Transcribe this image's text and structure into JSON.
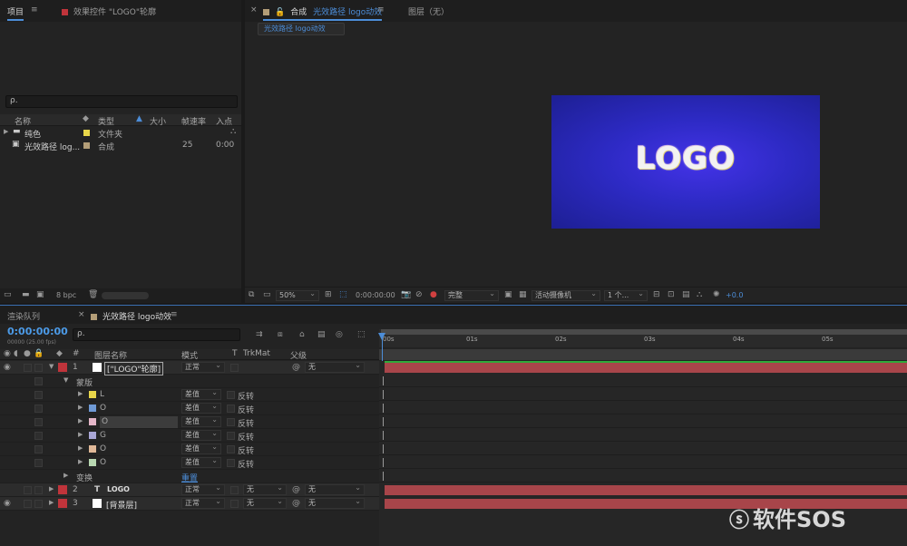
{
  "project_panel": {
    "tab_label": "项目",
    "effects_tab_label": "效果控件 \"LOGO\"轮廓",
    "search_placeholder": "ρ.",
    "columns": [
      "名称",
      "类型",
      "大小",
      "帧速率",
      "入点"
    ],
    "items": [
      {
        "name": "纯色",
        "type": "文件夹",
        "fps": "",
        "inpoint": "",
        "swatch": "#e8d64a"
      },
      {
        "name": "光效路径 log...",
        "type": "合成",
        "fps": "25",
        "inpoint": "0:00",
        "swatch": "#b49e78"
      }
    ],
    "bpc_label": "8 bpc"
  },
  "composition_panel": {
    "tab_label": "合成",
    "comp_name": "光效路径 logo动效",
    "layer_tab_label": "图层（无）",
    "subtab_label": "光效路径 logo动效",
    "logo_text": "LOGO",
    "zoom": "50%",
    "timecode": "0:00:00:00",
    "quality": "完整",
    "camera": "活动摄像机",
    "views": "1 个...",
    "exposure": "+0.0"
  },
  "timeline_panel": {
    "render_queue_label": "渲染队列",
    "comp_tab_label": "光效路径 logo动效",
    "timecode": "0:00:00:00",
    "frame_info": "00000 (25.00 fps)",
    "search_placeholder": "ρ.",
    "header": {
      "num": "#",
      "layer_name": "图层名称",
      "mode": "模式",
      "t": "T",
      "trkmat": "TrkMat",
      "parent": "父级"
    },
    "ruler_ticks": [
      "00s",
      "01s",
      "02s",
      "03s",
      "04s",
      "05s"
    ],
    "layers": [
      {
        "num": "1",
        "name": "[\"LOGO\"轮廓]",
        "mode": "正常",
        "trkmat": "",
        "parent": "无",
        "color": "#c0343b",
        "expanded": true,
        "kind": "solid-white"
      },
      {
        "num": "2",
        "name": "LOGO",
        "mode": "正常",
        "trkmat": "无",
        "parent": "无",
        "color": "#c0343b",
        "expanded": false,
        "kind": "text"
      },
      {
        "num": "3",
        "name": "[背景层]",
        "mode": "正常",
        "trkmat": "无",
        "parent": "无",
        "color": "#c0343b",
        "expanded": false,
        "kind": "solid-white"
      }
    ],
    "masks_group_label": "蒙版",
    "masks": [
      {
        "name": "L",
        "mode": "差值",
        "invert": "反转",
        "color": "#e8d64a"
      },
      {
        "name": "O",
        "mode": "差值",
        "invert": "反转",
        "color": "#6f9ad6"
      },
      {
        "name": "O",
        "mode": "差值",
        "invert": "反转",
        "color": "#e4b6c8"
      },
      {
        "name": "G",
        "mode": "差值",
        "invert": "反转",
        "color": "#a9a6d6"
      },
      {
        "name": "O",
        "mode": "差值",
        "invert": "反转",
        "color": "#e0b898"
      },
      {
        "name": "O",
        "mode": "差值",
        "invert": "反转",
        "color": "#b7d6b0"
      }
    ],
    "transform_label": "变换",
    "reset_label": "重置"
  },
  "watermark": "软件SOS"
}
